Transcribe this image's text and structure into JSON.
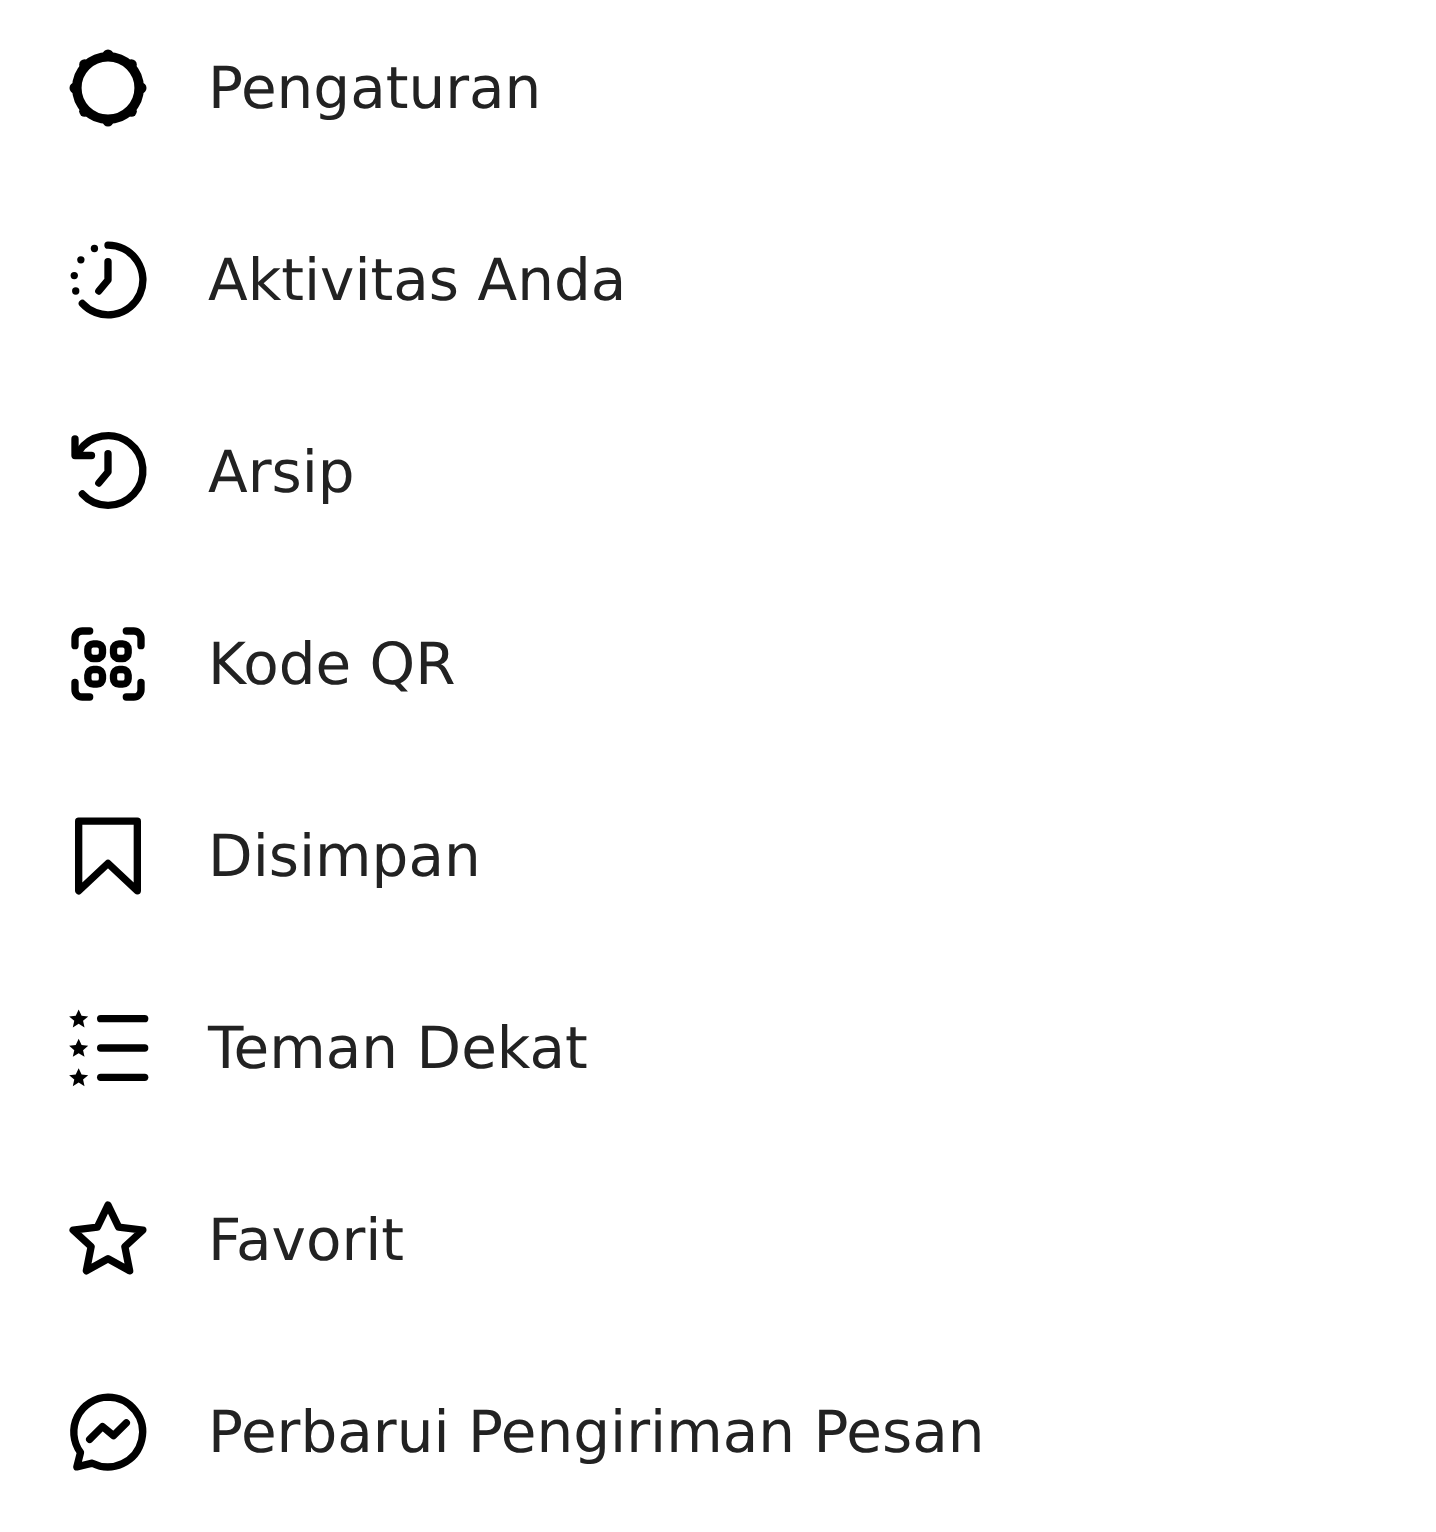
{
  "menu": [
    {
      "kind": "settings",
      "label": "Pengaturan"
    },
    {
      "kind": "activity",
      "label": "Aktivitas Anda"
    },
    {
      "kind": "archive",
      "label": "Arsip"
    },
    {
      "kind": "qr",
      "label": "Kode QR"
    },
    {
      "kind": "saved",
      "label": "Disimpan"
    },
    {
      "kind": "close-friends",
      "label": "Teman Dekat"
    },
    {
      "kind": "favorites",
      "label": "Favorit"
    },
    {
      "kind": "messenger",
      "label": "Perbarui Pengiriman Pesan"
    }
  ]
}
